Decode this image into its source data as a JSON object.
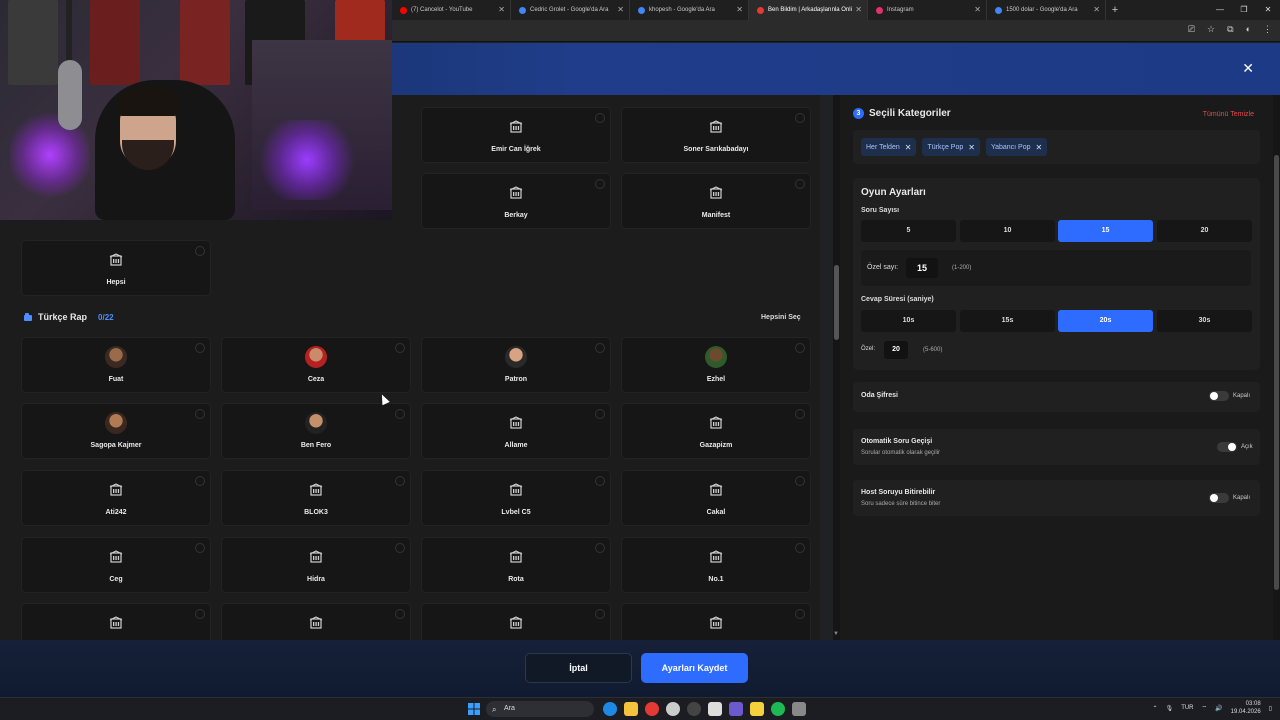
{
  "browser": {
    "tabs": [
      {
        "title": "(7) Cancelot - YouTube",
        "color": "#ff0000",
        "active": false
      },
      {
        "title": "Cedric Grolet - Google'da Ara",
        "color": "#4285f4",
        "active": false
      },
      {
        "title": "khopesh - Google'da Ara",
        "color": "#4285f4",
        "active": false
      },
      {
        "title": "Ben Bildim | Arkadaşlarınla Onli",
        "color": "#e53935",
        "active": true
      },
      {
        "title": "Instagram",
        "color": "#e1306c",
        "active": false
      },
      {
        "title": "1500 dolar - Google'da Ara",
        "color": "#4285f4",
        "active": false
      }
    ]
  },
  "top_grid": [
    {
      "label": "",
      "col": 0,
      "row": 0
    },
    {
      "label": "Emir Can İğrek",
      "col": 2,
      "row": 0
    },
    {
      "label": "Soner Sarıkabadayı",
      "col": 3,
      "row": 0
    },
    {
      "label": "Berkay",
      "col": 2,
      "row": 1
    },
    {
      "label": "Manifest",
      "col": 3,
      "row": 1
    },
    {
      "label": "Hepsi",
      "col": 0,
      "row": 2
    }
  ],
  "section": {
    "title": "Türkçe Rap",
    "count": "0/22",
    "select_all": "Hepsini Seç"
  },
  "artists": [
    {
      "label": "Fuat",
      "avatar": true,
      "skin": "#9a6b4a",
      "bg": "#3a2a20"
    },
    {
      "label": "Ceza",
      "avatar": true,
      "skin": "#c98b6a",
      "bg": "#b52020"
    },
    {
      "label": "Patron",
      "avatar": true,
      "skin": "#d8a383",
      "bg": "#2a2a2a"
    },
    {
      "label": "Ezhel",
      "avatar": true,
      "skin": "#6b4a30",
      "bg": "#2f5a2a"
    },
    {
      "label": "Sagopa Kajmer",
      "avatar": true,
      "skin": "#b07a55",
      "bg": "#3a2820"
    },
    {
      "label": "Ben Fero",
      "avatar": true,
      "skin": "#c4906a",
      "bg": "#222"
    },
    {
      "label": "Allame",
      "avatar": false
    },
    {
      "label": "Gazapizm",
      "avatar": false
    },
    {
      "label": "Ati242",
      "avatar": false
    },
    {
      "label": "BLOK3",
      "avatar": false
    },
    {
      "label": "Lvbel C5",
      "avatar": false
    },
    {
      "label": "Cakal",
      "avatar": false
    },
    {
      "label": "Ceg",
      "avatar": false
    },
    {
      "label": "Hidra",
      "avatar": false
    },
    {
      "label": "Rota",
      "avatar": false
    },
    {
      "label": "No.1",
      "avatar": false
    },
    {
      "label": "",
      "avatar": false
    },
    {
      "label": "",
      "avatar": false
    },
    {
      "label": "",
      "avatar": false
    },
    {
      "label": "",
      "avatar": false
    }
  ],
  "selected": {
    "step": "3",
    "title": "Seçili Kategoriler",
    "clear_all": "Tümünü Temizle",
    "chips": [
      "Her Telden",
      "Türkçe Pop",
      "Yabancı Pop"
    ]
  },
  "game_settings": {
    "title": "Oyun Ayarları",
    "question_count": {
      "label": "Soru Sayısı",
      "options": [
        "5",
        "10",
        "15",
        "20"
      ],
      "selected": "15",
      "custom_label": "Özel sayı:",
      "custom_value": "15",
      "custom_range": "(1-200)"
    },
    "answer_time": {
      "label": "Cevap Süresi (saniye)",
      "options": [
        "10s",
        "15s",
        "20s",
        "30s"
      ],
      "selected": "20s",
      "custom_label": "Özel:",
      "custom_value": "20",
      "custom_range": "(5-600)"
    }
  },
  "toggles": {
    "room_password": {
      "title": "Oda Şifresi",
      "desc": "",
      "state": "Kapalı",
      "on": false
    },
    "auto_next": {
      "title": "Otomatik Soru Geçişi",
      "desc": "Sorular otomatik olarak geçilir",
      "state": "Açık",
      "on": true
    },
    "host_finish": {
      "title": "Host Soruyu Bitirebilir",
      "desc": "Soru sadece süre bitince biter",
      "state": "Kapalı",
      "on": false
    }
  },
  "footer": {
    "cancel": "İptal",
    "save": "Ayarları Kaydet"
  },
  "taskbar": {
    "search": "Ara",
    "lang": "TUR",
    "time": "03:08",
    "date": "19.04.2026"
  },
  "colors": {
    "accent": "#2e6bff",
    "danger": "#e24a4a",
    "header_blue": "#1f3d8a"
  }
}
